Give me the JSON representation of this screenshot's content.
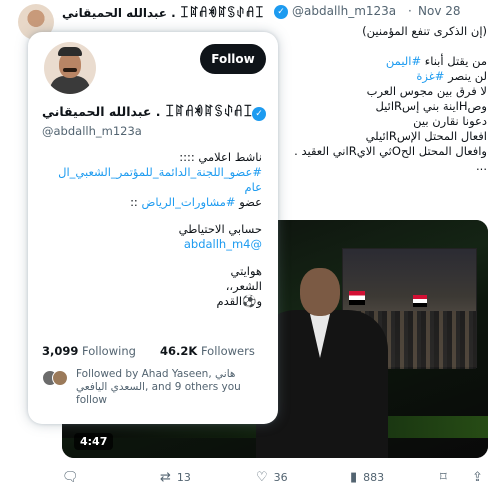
{
  "tweet": {
    "author_name": "عبدالله الحميقاني . ꀤꍏꋬꏓꍏꌗꂑꋬꀤ",
    "handle": "@abdallh_m123a",
    "separator": "·",
    "date": "Nov 28",
    "text_lines": [
      {
        "parts": [
          {
            "t": "(إن الذكرى تنفع المؤمنين)",
            "link": false
          }
        ]
      },
      {
        "parts": [
          {
            "t": "",
            "link": false
          }
        ]
      },
      {
        "parts": [
          {
            "t": "من يقتل أبناء ",
            "link": false
          },
          {
            "t": "#اليمن",
            "link": true
          }
        ]
      },
      {
        "parts": [
          {
            "t": "لن ينصر ",
            "link": false
          },
          {
            "t": "#غزة",
            "link": true
          }
        ]
      },
      {
        "parts": [
          {
            "t": "لا فرق بين  مجوس العرب",
            "link": false
          }
        ]
      },
      {
        "parts": [
          {
            "t": "وصHاينة بني إسRائيل",
            "link": false
          }
        ]
      },
      {
        "parts": [
          {
            "t": "دعونا نقارن بين",
            "link": false
          }
        ]
      },
      {
        "parts": [
          {
            "t": "افعال المحتل الإسRائيلي",
            "link": false
          }
        ]
      },
      {
        "parts": [
          {
            "t": "وافعال المحتل الحOثي الايRاني العقيد .",
            "link": false
          }
        ]
      },
      {
        "parts": [
          {
            "t": "...",
            "link": false
          }
        ]
      }
    ],
    "media": {
      "duration": "4:47"
    },
    "actions": {
      "reply_count": "",
      "retweet_count": "13",
      "like_count": "36",
      "view_count": "883"
    },
    "icons": {
      "reply": "reply-icon",
      "retweet": "retweet-icon",
      "like": "heart-icon",
      "views": "views-icon",
      "bookmark": "bookmark-icon",
      "share": "share-icon"
    }
  },
  "hovercard": {
    "follow_label": "Follow",
    "name": "عبدالله الحميقاني . ꀤꍏꋬꏓꍏꌗꂑꋬꀤ",
    "handle": "@abdallh_m123a",
    "bio": {
      "line1": "ناشط اعلامي ::::",
      "line2": "#عضو_اللجنة_الدائمة_للمؤتمر_الشعبي_ال",
      "line3": "عام",
      "line4_prefix": "عضو ",
      "line4_tag": "#مشاورات_الرياض",
      "line4_suffix": " ::",
      "line5": "حسابي الاحتياطي",
      "line6": "@abdallh_m4",
      "line7": "هوايتي",
      "line8": "الشعر،،",
      "line9": "و⚽القدم"
    },
    "following_count": "3,099",
    "following_label": "Following",
    "followers_count": "46.2K",
    "followers_label": "Followers",
    "followed_by": "Followed by Ahad Yaseen, هاني السعدي اليافعي, and 9 others you follow"
  },
  "colors": {
    "accent": "#1d9bf0",
    "text": "#0f1419",
    "muted": "#536471",
    "button_bg": "#0f1419"
  }
}
